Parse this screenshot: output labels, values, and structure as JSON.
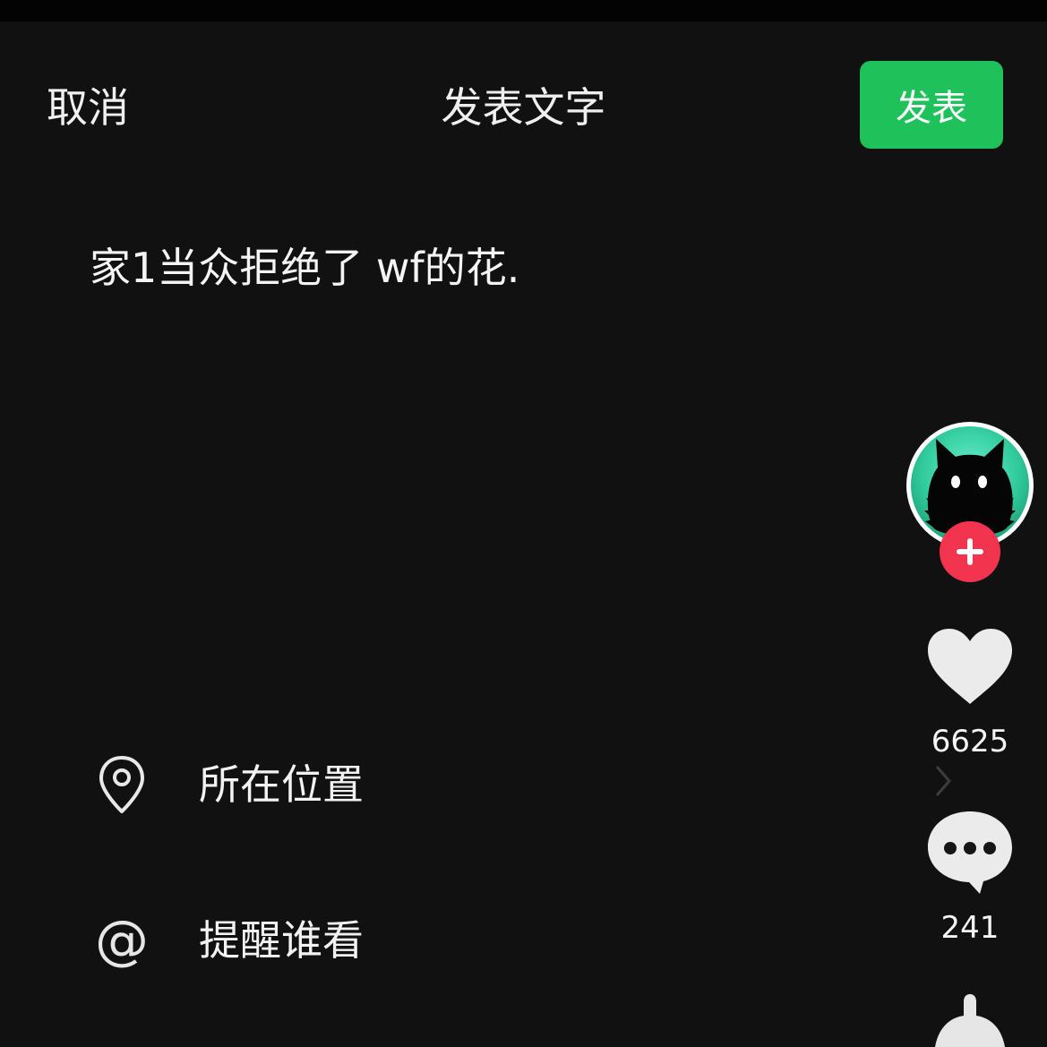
{
  "header": {
    "cancel_label": "取消",
    "title": "发表文字",
    "publish_label": "发表",
    "publish_color": "#1fc15a"
  },
  "post": {
    "text": "家1当众拒绝了 wf的花."
  },
  "options": {
    "location": {
      "icon": "location-pin-icon",
      "label": "所在位置"
    },
    "mention": {
      "icon": "at-icon",
      "label": "提醒谁看"
    }
  },
  "side_actions": {
    "avatar": {
      "icon": "black-cat-avatar",
      "ring_color": "#3fd6a0"
    },
    "follow": {
      "icon": "plus-icon",
      "color": "#f2344f"
    },
    "like": {
      "icon": "heart-icon",
      "count": "6625"
    },
    "comment": {
      "icon": "comment-bubble-icon",
      "count": "241"
    },
    "share": {
      "icon": "share-icon"
    }
  }
}
